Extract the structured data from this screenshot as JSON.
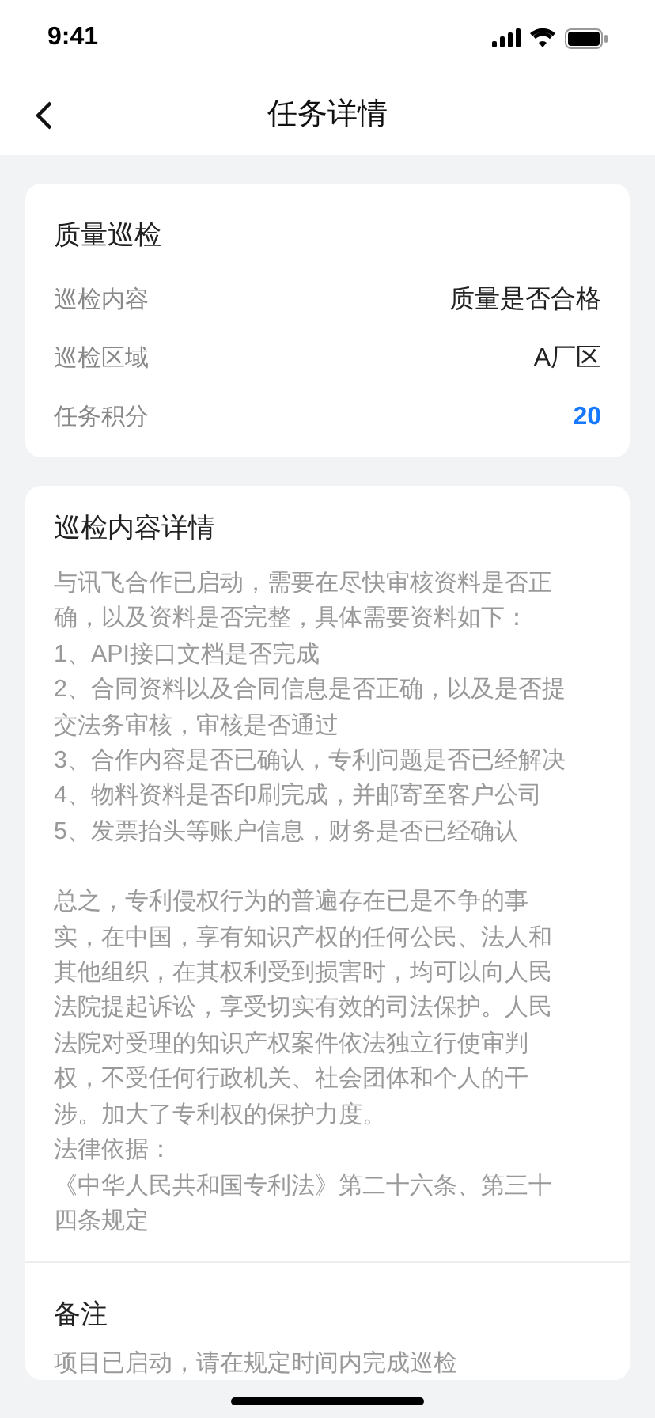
{
  "status_bar": {
    "time": "9:41"
  },
  "header": {
    "title": "任务详情"
  },
  "summary": {
    "title": "质量巡检",
    "rows": [
      {
        "label": "巡检内容",
        "value": "质量是否合格",
        "highlight": false
      },
      {
        "label": "巡检区域",
        "value": "A厂区",
        "highlight": false
      },
      {
        "label": "任务积分",
        "value": "20",
        "highlight": true
      }
    ]
  },
  "details": {
    "title": "巡检内容详情",
    "paragraphs": [
      "与讯飞合作已启动，需要在尽快审核资料是否正确，以及资料是否完整，具体需要资料如下：",
      "1、API接口文档是否完成",
      "2、合同资料以及合同信息是否正确，以及是否提交法务审核，审核是否通过",
      "3、合作内容是否已确认，专利问题是否已经解决",
      "4、物料资料是否印刷完成，并邮寄至客户公司",
      "5、发票抬头等账户信息，财务是否已经确认"
    ],
    "paragraphs_2": [
      "总之，专利侵权行为的普遍存在已是不争的事实，在中国，享有知识产权的任何公民、法人和其他组织，在其权利受到损害时，均可以向人民法院提起诉讼，享受切实有效的司法保护。人民法院对受理的知识产权案件依法独立行使审判权，不受任何行政机关、社会团体和个人的干涉。加大了专利权的保护力度。",
      "法律依据：",
      "《中华人民共和国专利法》第二十六条、第三十四条规定"
    ]
  },
  "remarks": {
    "title": "备注",
    "text": "项目已启动，请在规定时间内完成巡检"
  }
}
